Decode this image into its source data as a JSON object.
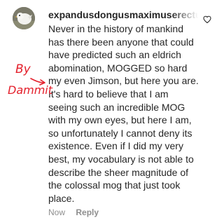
{
  "comment": {
    "avatar_icon": "profile-picture-white-bird",
    "username": "expandusdongusmaximuserectus",
    "lines": [
      "Never in the history of mankind",
      "has there been anyone that could",
      "have predicted such an eldrich",
      "abomination, MOGGED so hard",
      "my even Jimson, but here you are.",
      "It's hard to believe that I am",
      "seeing such an incredible MOG",
      "with my own eyes, but here I am,",
      "so unfortunately I cannot deny its",
      "existence. Even if I did my very",
      "best, my vocabulary is not able to",
      "describe the sheer magnitude of",
      "the colossal mog that just took",
      "place."
    ],
    "time": "Now",
    "reply_label": "Reply",
    "like_icon": "heart-outline-icon"
  },
  "annotation": {
    "line1": "By",
    "line2": "Dammit",
    "color": "#e4202c"
  }
}
